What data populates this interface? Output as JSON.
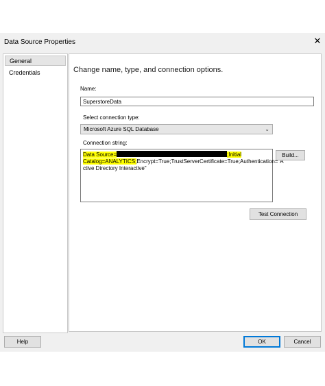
{
  "window": {
    "title": "Data Source Properties",
    "close_glyph": "✕"
  },
  "sidebar": {
    "items": [
      {
        "label": "General",
        "selected": true
      },
      {
        "label": "Credentials",
        "selected": false
      }
    ]
  },
  "general": {
    "heading": "Change name, type, and connection options.",
    "name_label": "Name:",
    "name_value": "SuperstoreData",
    "connection_type_label": "Select connection type:",
    "connection_type_value": "Microsoft Azure SQL Database",
    "connection_string_label": "Connection string:",
    "connection_string": {
      "part1": "Data Source=",
      "part2": ";Initial",
      "part3": "Catalog=ANALYTICS;",
      "part4": "Encrypt=True;TrustServerCertificate=True;Authentication=\"A",
      "part5": "ctive Directory Interactive\""
    },
    "build_button": "Build...",
    "test_connection_button": "Test Connection"
  },
  "footer": {
    "help_button": "Help",
    "ok_button": "OK",
    "cancel_button": "Cancel"
  },
  "colors": {
    "highlight": "#ffff00",
    "dialog_bg": "#f0f0f0",
    "primary_border": "#0078d7"
  }
}
